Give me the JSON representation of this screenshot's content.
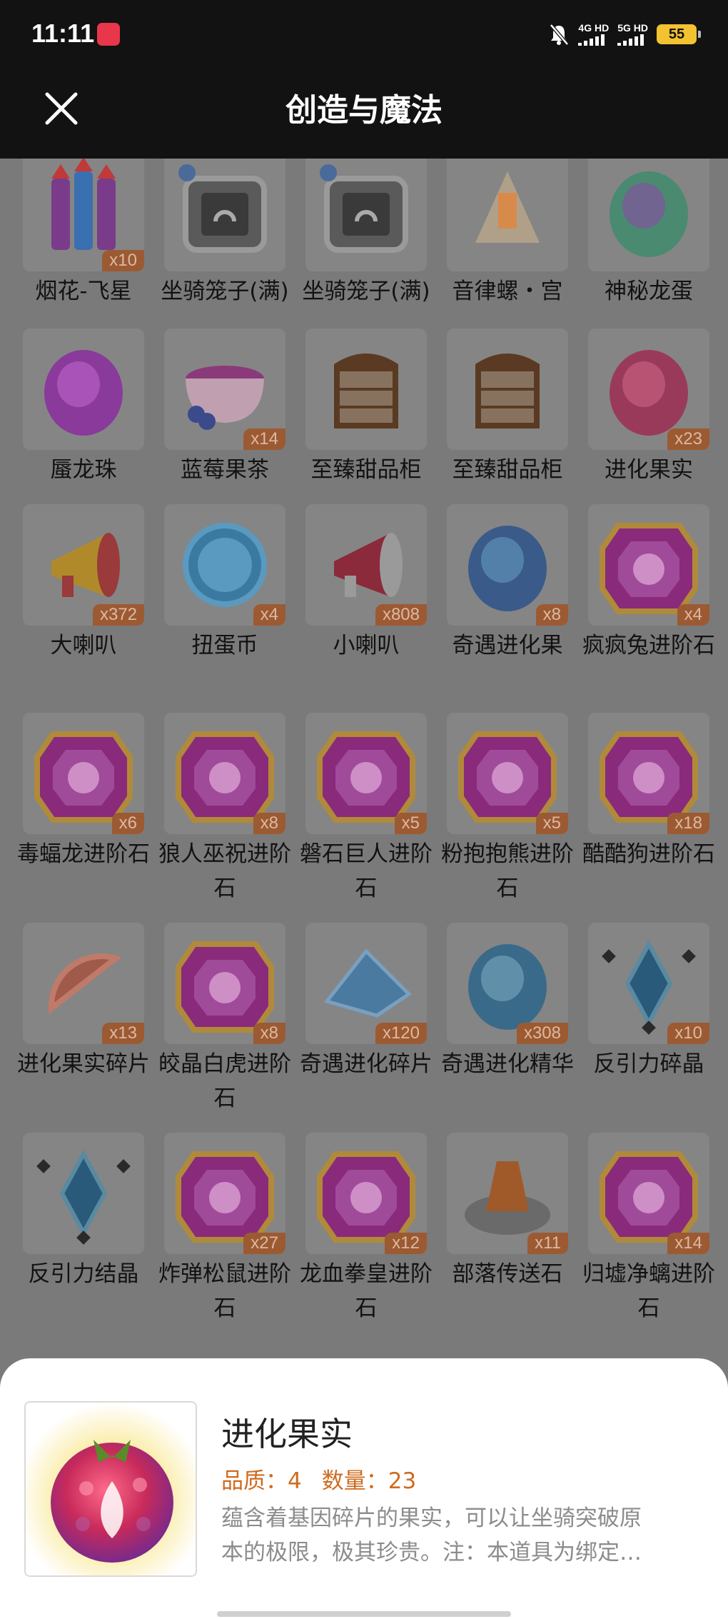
{
  "status_bar": {
    "time": "11:11",
    "net_1": "4G HD",
    "net_2": "5G HD",
    "battery": "55"
  },
  "header": {
    "title": "创造与魔法",
    "close_icon": "close-icon"
  },
  "items": [
    {
      "name": "烟花-飞星",
      "qty": "x10",
      "icon": "firework-icon",
      "colors": [
        "#7a3c8a",
        "#3a6fb0"
      ]
    },
    {
      "name": "坐骑笼子(满)",
      "qty": "",
      "icon": "cage-icon",
      "colors": [
        "#5a5a5a",
        "#3a3a3a"
      ]
    },
    {
      "name": "坐骑笼子(满)",
      "qty": "",
      "icon": "cage-icon",
      "colors": [
        "#5a5a5a",
        "#3a3a3a"
      ]
    },
    {
      "name": "音律螺・宫",
      "qty": "",
      "icon": "conch-icon",
      "colors": [
        "#b0a08a",
        "#d88a4a"
      ]
    },
    {
      "name": "神秘龙蛋",
      "qty": "",
      "icon": "dragon-egg-icon",
      "colors": [
        "#4a8a70",
        "#7a5a9a"
      ]
    },
    {
      "name": "蜃龙珠",
      "qty": "",
      "icon": "orb-icon",
      "colors": [
        "#8a3a9a",
        "#b05ac0"
      ]
    },
    {
      "name": "蓝莓果茶",
      "qty": "x14",
      "icon": "tea-icon",
      "colors": [
        "#8a3a7a",
        "#3a4a8a"
      ]
    },
    {
      "name": "至臻甜品柜",
      "qty": "",
      "icon": "cabinet-icon",
      "colors": [
        "#5a3a22",
        "#8a6a4a"
      ]
    },
    {
      "name": "至臻甜品柜",
      "qty": "",
      "icon": "cabinet-icon",
      "colors": [
        "#5a3a22",
        "#8a6a4a"
      ]
    },
    {
      "name": "进化果实",
      "qty": "x23",
      "icon": "berry-icon",
      "colors": [
        "#9a3a5a",
        "#c05a7a"
      ]
    },
    {
      "name": "大喇叭",
      "qty": "x372",
      "icon": "megaphone-icon",
      "colors": [
        "#b08a2a",
        "#9a3a3a"
      ]
    },
    {
      "name": "扭蛋币",
      "qty": "x4",
      "icon": "coin-icon",
      "colors": [
        "#3a7aa0",
        "#5a9ac0"
      ]
    },
    {
      "name": "小喇叭",
      "qty": "x808",
      "icon": "small-horn-icon",
      "colors": [
        "#8a2a3a",
        "#9a9a9a"
      ]
    },
    {
      "name": "奇遇进化果",
      "qty": "x8",
      "icon": "blue-fruit-icon",
      "colors": [
        "#3a5a8a",
        "#5a8ab0"
      ]
    },
    {
      "name": "疯疯兔进阶石",
      "qty": "x4",
      "icon": "gem-icon",
      "colors": [
        "#8a2a7a",
        "#b08a3a"
      ]
    },
    {
      "name": "毒蝠龙进阶石",
      "qty": "x6",
      "icon": "gem-icon",
      "colors": [
        "#8a2a7a",
        "#b08a3a"
      ]
    },
    {
      "name": "狼人巫祝进阶石",
      "qty": "x8",
      "icon": "gem-icon",
      "colors": [
        "#8a2a7a",
        "#b08a3a"
      ]
    },
    {
      "name": "磐石巨人进阶石",
      "qty": "x5",
      "icon": "gem-icon",
      "colors": [
        "#8a2a7a",
        "#b08a3a"
      ]
    },
    {
      "name": "粉抱抱熊进阶石",
      "qty": "x5",
      "icon": "gem-icon",
      "colors": [
        "#8a2a7a",
        "#b08a3a"
      ]
    },
    {
      "name": "酷酷狗进阶石",
      "qty": "x18",
      "icon": "gem-icon",
      "colors": [
        "#8a2a7a",
        "#b08a3a"
      ]
    },
    {
      "name": "进化果实碎片",
      "qty": "x13",
      "icon": "fruit-slice-icon",
      "colors": [
        "#a05a4a",
        "#c07a6a"
      ]
    },
    {
      "name": "皎晶白虎进阶石",
      "qty": "x8",
      "icon": "gem-icon",
      "colors": [
        "#8a2a7a",
        "#b08a3a"
      ]
    },
    {
      "name": "奇遇进化碎片",
      "qty": "x120",
      "icon": "crystal-shard-icon",
      "colors": [
        "#4a7aa0",
        "#7aa0c0"
      ]
    },
    {
      "name": "奇遇进化精华",
      "qty": "x308",
      "icon": "essence-icon",
      "colors": [
        "#3a6a8a",
        "#6a9ab0"
      ]
    },
    {
      "name": "反引力碎晶",
      "qty": "x10",
      "icon": "anti-gravity-shard-icon",
      "colors": [
        "#2a5a7a",
        "#5a8aa0"
      ]
    },
    {
      "name": "反引力结晶",
      "qty": "",
      "icon": "anti-gravity-crystal-icon",
      "colors": [
        "#2a5a7a",
        "#5a8aa0"
      ]
    },
    {
      "name": "炸弹松鼠进阶石",
      "qty": "x27",
      "icon": "gem-icon",
      "colors": [
        "#8a2a7a",
        "#b08a3a"
      ]
    },
    {
      "name": "龙血拳皇进阶石",
      "qty": "x12",
      "icon": "gem-icon",
      "colors": [
        "#8a2a7a",
        "#b08a3a"
      ]
    },
    {
      "name": "部落传送石",
      "qty": "x11",
      "icon": "teleport-stone-icon",
      "colors": [
        "#6a6a6a",
        "#a05a2a"
      ]
    },
    {
      "name": "归墟净螭进阶石",
      "qty": "x14",
      "icon": "gem-icon",
      "colors": [
        "#8a2a7a",
        "#b08a3a"
      ]
    }
  ],
  "detail": {
    "title": "进化果实",
    "quality": "品质：4",
    "count": "数量：23",
    "desc_line1": "蕴含着基因碎片的果实，可以让坐骑突破原",
    "desc_line2": "本的极限，极其珍贵。注：本道具为绑定…",
    "icon": "evolution-fruit-icon"
  }
}
